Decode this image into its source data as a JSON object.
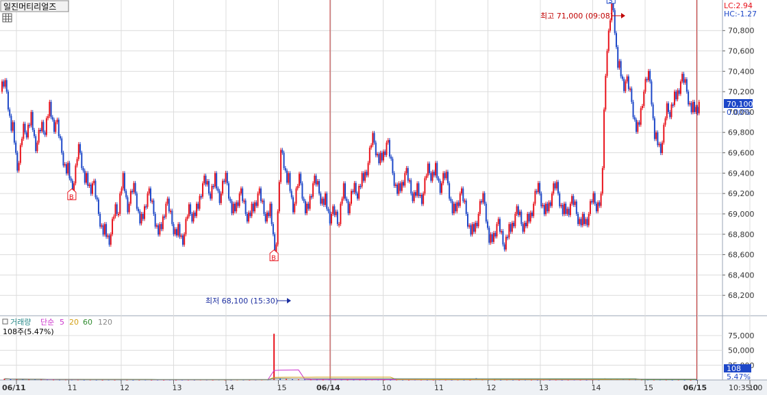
{
  "stock_name": "일진머티리얼즈",
  "lc_label": "LC:2.94",
  "hc_label": "HC:-1.27",
  "current_price": "70,100",
  "current_change": "0.00%",
  "high_annotation": "최고 71,000 (09:08)",
  "low_annotation": "최저 68,100 (15:30)",
  "signal_marks": [
    {
      "label": "B",
      "time": "06/11 10:4x"
    },
    {
      "label": "B",
      "time": "06/14 15:30"
    },
    {
      "label": "S",
      "time": "06/15 09:0x"
    }
  ],
  "volume_panel": {
    "title": "거래량",
    "ma_label": "단순",
    "ma_periods": [
      "5",
      "20",
      "60",
      "120"
    ],
    "last_volume_text": "108주(5.47%)",
    "current_volume": "108",
    "current_volume_pct": "5.47%",
    "y_ticks": [
      "75,000",
      "50,000",
      "25,000"
    ]
  },
  "time_readout": "10:35:00",
  "colors": {
    "up": "#e8121b",
    "down": "#1d47c8",
    "grid": "#dcdcdc",
    "axis_text": "#333333",
    "ma5": "#cc33cc",
    "ma20": "#d4a017",
    "ma60": "#2e8b2e",
    "ma120": "#888888",
    "price_tag": "#1d47c8"
  },
  "chart_data": {
    "type": "candlestick",
    "price_axis": {
      "ticks": [
        "68,200",
        "68,400",
        "68,600",
        "68,800",
        "69,000",
        "69,200",
        "69,400",
        "69,600",
        "69,800",
        "70,000",
        "70,200",
        "70,400",
        "70,600",
        "70,800"
      ],
      "ylim": [
        68000,
        71100
      ]
    },
    "x_axis": {
      "ticks": [
        {
          "label": "06/11",
          "bold": true
        },
        {
          "label": "11"
        },
        {
          "label": "12"
        },
        {
          "label": "13"
        },
        {
          "label": "14"
        },
        {
          "label": "15"
        },
        {
          "label": "06/14",
          "bold": true
        },
        {
          "label": "10"
        },
        {
          "label": "11"
        },
        {
          "label": "12"
        },
        {
          "label": "13"
        },
        {
          "label": "14"
        },
        {
          "label": "15"
        },
        {
          "label": "06/15",
          "bold": true
        },
        {
          "label": "10"
        }
      ]
    },
    "price_path": [
      70200,
      69900,
      69500,
      69800,
      70000,
      69700,
      69800,
      70100,
      69900,
      69600,
      69500,
      69300,
      69600,
      69400,
      69300,
      69000,
      68900,
      68800,
      69000,
      69400,
      69100,
      69200,
      69000,
      69200,
      69000,
      68900,
      69100,
      68900,
      68900,
      68800,
      69000,
      69100,
      69300,
      69200,
      69400,
      69200,
      69300,
      69100,
      69200,
      69000,
      69100,
      69200,
      69000,
      69100,
      68700,
      69600,
      69400,
      69100,
      69300,
      69100,
      69300,
      69200,
      69200,
      69000,
      68900,
      69300,
      69100,
      69200,
      69400,
      69500,
      69700,
      69600,
      69700,
      69400,
      69300,
      69400,
      69200,
      69300,
      69200,
      69400,
      69500,
      69300,
      69300,
      69100,
      69200,
      69000,
      68900,
      69000,
      69100,
      68800,
      68900,
      68700,
      68900,
      69000,
      68900,
      69000,
      69100,
      69200,
      69100,
      69200,
      69200,
      69100,
      69100,
      69000,
      69000,
      69000,
      69100,
      69200,
      70600,
      71000,
      70500,
      70300,
      70100,
      69900,
      70200,
      70300,
      69800,
      69700,
      70000,
      70200,
      70300,
      70200,
      70100,
      70100
    ],
    "volume_values": [
      2000,
      1500,
      1200,
      1000,
      900,
      1100,
      800,
      900,
      700,
      600,
      800,
      700,
      600,
      500,
      600,
      500,
      400,
      600,
      500,
      700,
      500,
      400,
      500,
      600,
      400,
      500,
      400,
      600,
      400,
      500,
      500,
      400,
      600,
      500,
      400,
      700,
      500,
      400,
      600,
      500,
      400,
      500,
      600,
      800,
      78000,
      3000,
      1500,
      1200,
      1000,
      900,
      800,
      700,
      600,
      800,
      900,
      600,
      500,
      600,
      700,
      500,
      800,
      600,
      500,
      400,
      600,
      500,
      400,
      600,
      500,
      400,
      500,
      600,
      500,
      400,
      600,
      500,
      400,
      3000,
      800,
      600,
      500,
      400,
      700,
      500,
      400,
      600,
      500,
      400,
      600,
      400,
      500,
      400,
      500,
      600,
      500,
      400,
      500,
      600,
      2500,
      1800,
      1500,
      1200,
      1000,
      900,
      800,
      700,
      600,
      700,
      600,
      500,
      600,
      500,
      400,
      300
    ],
    "volume_ylim": [
      0,
      90000
    ]
  }
}
